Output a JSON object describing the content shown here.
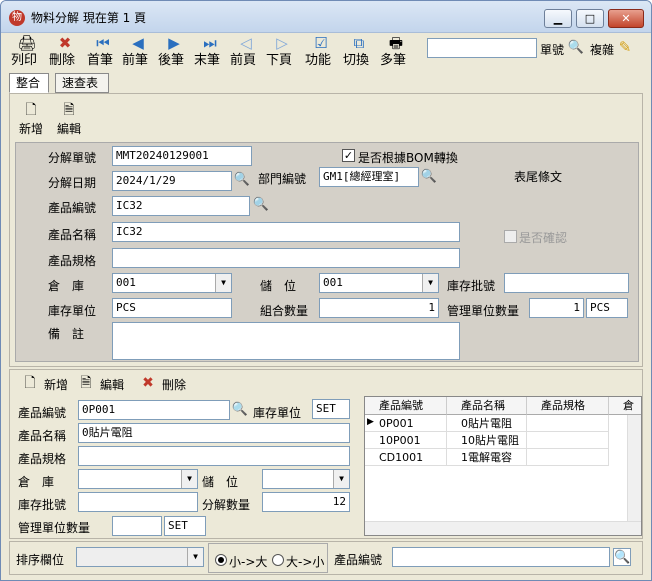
{
  "window": {
    "title": "物料分解  現在第 1 頁",
    "minimize": "▁",
    "maximize": "□",
    "close": "✕"
  },
  "toolbar": {
    "buttons": [
      {
        "label": "列印",
        "icon": "🖨"
      },
      {
        "label": "刪除",
        "icon": "✖"
      },
      {
        "label": "首筆",
        "icon": "⏮"
      },
      {
        "label": "前筆",
        "icon": "◀"
      },
      {
        "label": "後筆",
        "icon": "▶"
      },
      {
        "label": "末筆",
        "icon": "⏭"
      },
      {
        "label": "前頁",
        "icon": "◁"
      },
      {
        "label": "下頁",
        "icon": "▷"
      },
      {
        "label": "功能",
        "icon": "☑"
      },
      {
        "label": "切換",
        "icon": "⧉"
      },
      {
        "label": "多筆",
        "icon": "🖶"
      }
    ],
    "search_value": "",
    "search_label": "單號",
    "copy_label": "複雜"
  },
  "tabs": [
    {
      "label": "整合"
    },
    {
      "label": "速查表"
    }
  ],
  "header_actions": {
    "new_label": "新增",
    "edit_label": "編輯"
  },
  "form": {
    "doc_no_label": "分解單號",
    "doc_no": "MMT20240129001",
    "bom_label": "是否根據BOM轉換",
    "bom_checked": "✓",
    "date_label": "分解日期",
    "date": "2024/1/29",
    "dept_label": "部門編號",
    "dept": "GM1[總經理室]",
    "footer_label": "表尾條文",
    "product_no_label": "產品編號",
    "product_no": "IC32",
    "product_name_label": "產品名稱",
    "product_name": "IC32",
    "confirm_label": "是否確認",
    "spec_label": "產品規格",
    "spec": "",
    "warehouse_label": "倉　庫",
    "warehouse": "001",
    "location_label": "儲　位",
    "location": "001",
    "batch_label": "庫存批號",
    "batch": "",
    "unit_label": "庫存單位",
    "unit": "PCS",
    "qty_label": "組合數量",
    "qty": "1",
    "mgmt_qty_label": "管理單位數量",
    "mgmt_qty": "1",
    "mgmt_unit": "PCS",
    "note_label": "備　註",
    "note": ""
  },
  "detail_actions": {
    "new_label": "新增",
    "edit_label": "編輯",
    "delete_label": "刪除"
  },
  "detail": {
    "product_no_label": "產品編號",
    "product_no": "0P001",
    "unit_label": "庫存單位",
    "unit": "SET",
    "product_name_label": "產品名稱",
    "product_name": "0貼片電阻",
    "spec_label": "產品規格",
    "spec": "",
    "warehouse_label": "倉　庫",
    "warehouse": "",
    "location_label": "儲　位",
    "location": "",
    "batch_label": "庫存批號",
    "batch": "",
    "qty_label": "分解數量",
    "qty": "12",
    "mgmt_qty_label": "管理單位數量",
    "mgmt_qty": "",
    "mgmt_unit": "SET"
  },
  "grid": {
    "headers": [
      "產品編號",
      "產品名稱",
      "產品規格",
      "倉"
    ],
    "rows": [
      {
        "no": "0P001",
        "name": "0貼片電阻",
        "spec": ""
      },
      {
        "no": "10P001",
        "name": "10貼片電阻",
        "spec": ""
      },
      {
        "no": "CD1001",
        "name": "1電解電容",
        "spec": ""
      }
    ],
    "row_marker": "▶"
  },
  "status": {
    "sort_label": "排序欄位",
    "sort_value": "",
    "asc_label": "小->大",
    "desc_label": "大->小",
    "product_no_label": "產品編號",
    "product_no": ""
  }
}
